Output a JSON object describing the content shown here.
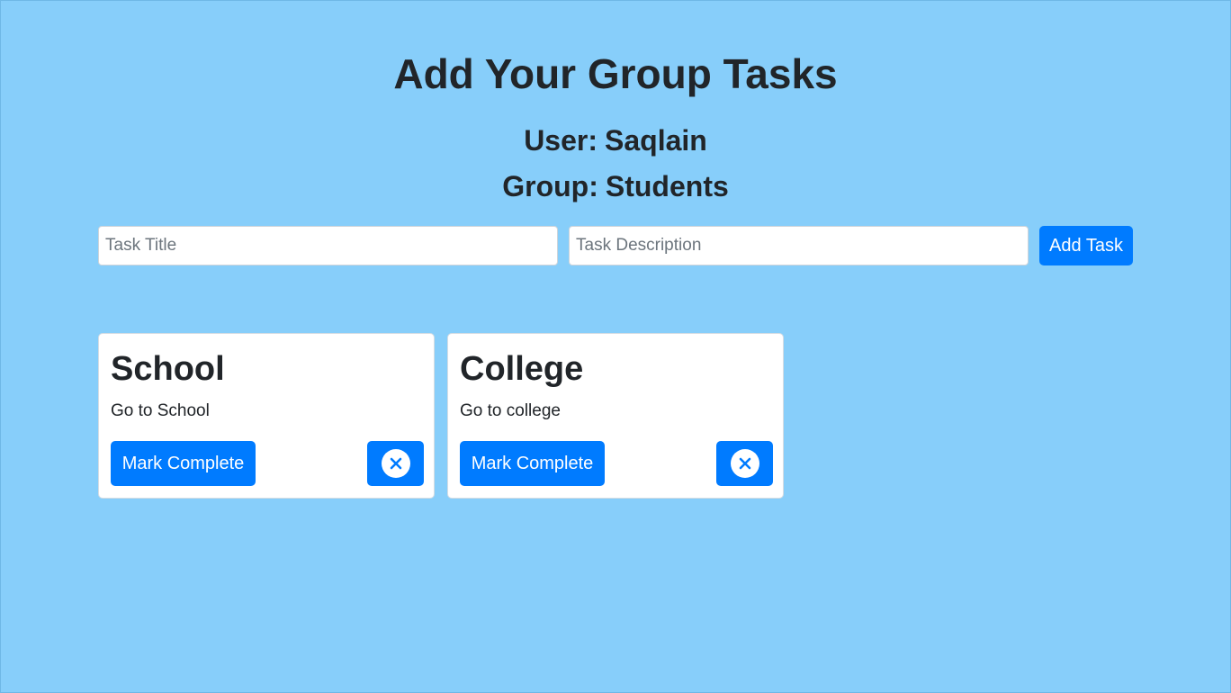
{
  "header": {
    "title": "Add Your Group Tasks",
    "user_label": "User:",
    "user_name": "Saqlain",
    "group_label": "Group:",
    "group_name": "Students"
  },
  "form": {
    "title_placeholder": "Task Title",
    "title_value": "",
    "description_placeholder": "Task Description",
    "description_value": "",
    "add_label": "Add Task"
  },
  "tasks": [
    {
      "title": "School",
      "description": "Go to School",
      "complete_label": "Mark Complete",
      "delete_icon": "close-circle-icon"
    },
    {
      "title": "College",
      "description": "Go to college",
      "complete_label": "Mark Complete",
      "delete_icon": "close-circle-icon"
    }
  ],
  "colors": {
    "background": "#87cefa",
    "primary": "#007bff",
    "text": "#212529"
  }
}
